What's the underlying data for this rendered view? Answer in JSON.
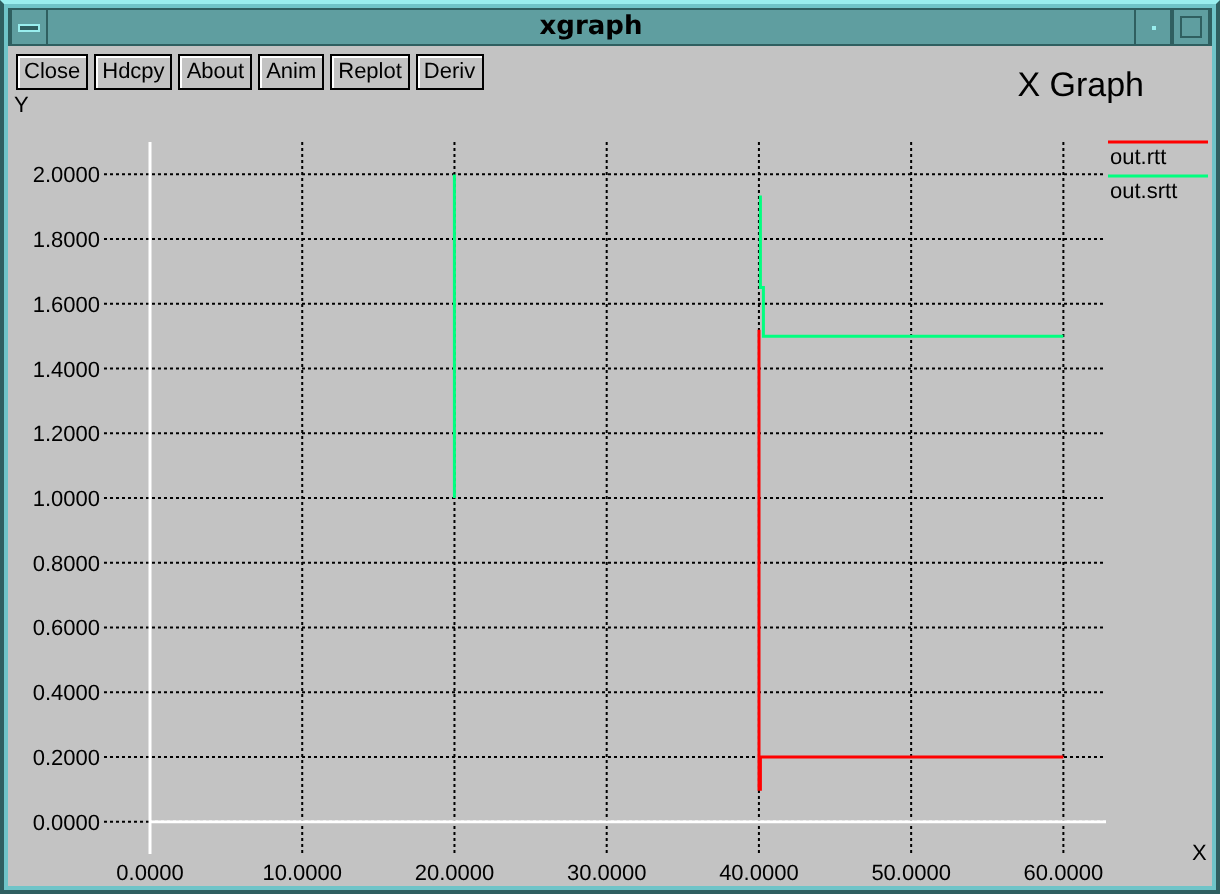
{
  "window": {
    "title": "xgraph"
  },
  "buttons": [
    "Close",
    "Hdcpy",
    "About",
    "Anim",
    "Replot",
    "Deriv"
  ],
  "graph_title": "X Graph",
  "chart_data": {
    "type": "line",
    "xlabel": "X",
    "ylabel": "Y",
    "x": [
      20,
      20,
      40,
      40,
      40.1,
      40.1,
      40.3,
      40.3,
      60
    ],
    "series": [
      {
        "name": "out.rtt",
        "color": "#ff0000",
        "values": [
          null,
          null,
          1.52,
          0.1,
          0.1,
          0.2,
          0.2,
          0.2,
          0.2
        ]
      },
      {
        "name": "out.srtt",
        "color": "#00ff7f",
        "values": [
          2,
          1,
          null,
          1.93,
          1.93,
          1.65,
          1.65,
          1.5,
          1.5
        ]
      }
    ],
    "grid": true,
    "legend": true,
    "xlim": [
      0,
      62.8
    ],
    "ylim": [
      -0.1,
      2.1
    ],
    "xticks": [
      {
        "value": 0,
        "label": "0.0000"
      },
      {
        "value": 10,
        "label": "10.0000"
      },
      {
        "value": 20,
        "label": "20.0000"
      },
      {
        "value": 30,
        "label": "30.0000"
      },
      {
        "value": 40,
        "label": "40.0000"
      },
      {
        "value": 50,
        "label": "50.0000"
      },
      {
        "value": 60,
        "label": "60.0000"
      }
    ],
    "yticks": [
      {
        "value": 0,
        "label": "0.0000"
      },
      {
        "value": 0.2,
        "label": "0.2000"
      },
      {
        "value": 0.4,
        "label": "0.4000"
      },
      {
        "value": 0.6,
        "label": "0.6000"
      },
      {
        "value": 0.8,
        "label": "0.8000"
      },
      {
        "value": 1,
        "label": "1.0000"
      },
      {
        "value": 1.2,
        "label": "1.2000"
      },
      {
        "value": 1.4,
        "label": "1.4000"
      },
      {
        "value": 1.6,
        "label": "1.6000"
      },
      {
        "value": 1.8,
        "label": "1.8000"
      },
      {
        "value": 2,
        "label": "2.0000"
      }
    ]
  }
}
